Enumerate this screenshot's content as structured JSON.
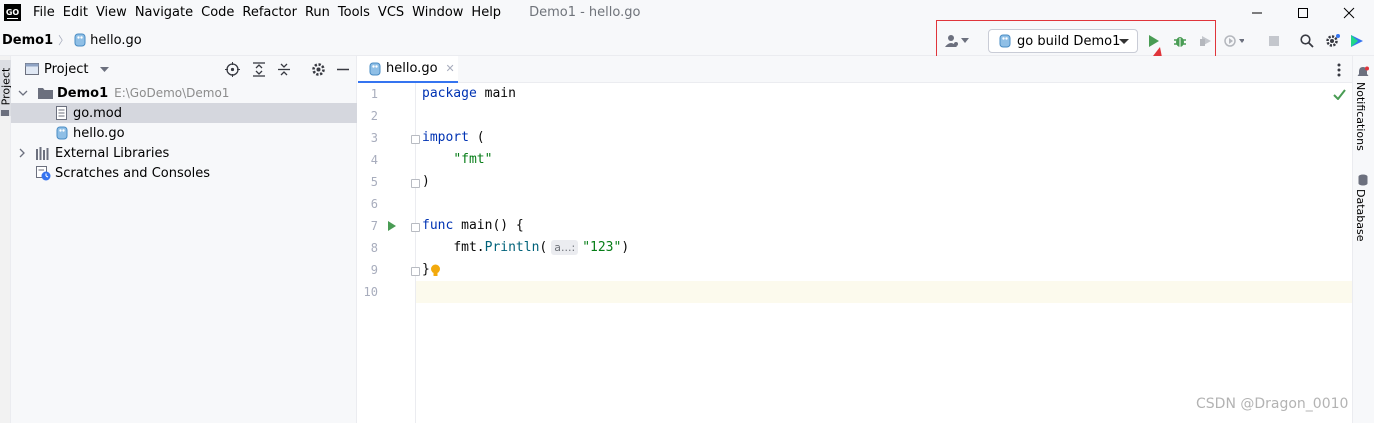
{
  "app": {
    "logo_text": "GO",
    "window_title": "Demo1 - hello.go"
  },
  "menu": [
    "File",
    "Edit",
    "View",
    "Navigate",
    "Code",
    "Refactor",
    "Run",
    "Tools",
    "VCS",
    "Window",
    "Help"
  ],
  "breadcrumb": {
    "project": "Demo1",
    "file": "hello.go"
  },
  "toolbar": {
    "run_config": "go build Demo1",
    "icons": [
      "user-icon",
      "run-icon",
      "debug-icon",
      "coverage-icon",
      "profile-icon",
      "stop-icon",
      "search-icon",
      "settings-icon",
      "plugin-icon"
    ],
    "colors": {
      "run": "#499c54",
      "highlight_box": "#e0353b",
      "arrow": "#e0353b"
    }
  },
  "stripes": {
    "left": "Project",
    "right_top": "Notifications",
    "right_bottom": "Database"
  },
  "project_panel": {
    "title": "Project",
    "tree": [
      {
        "label": "Demo1",
        "hint": "E:\\GoDemo\\Demo1",
        "icon": "folder-icon"
      },
      {
        "label": "go.mod",
        "icon": "gomod-file-icon"
      },
      {
        "label": "hello.go",
        "icon": "go-file-icon"
      },
      {
        "label": "External Libraries",
        "icon": "library-icon"
      },
      {
        "label": "Scratches and Consoles",
        "icon": "scratch-icon"
      }
    ]
  },
  "editor": {
    "tab": "hello.go",
    "line_numbers": [
      "1",
      "2",
      "3",
      "4",
      "5",
      "6",
      "7",
      "8",
      "9",
      "10"
    ],
    "current_line": "10",
    "inlay_hint": "a...:",
    "code": {
      "l1_kw": "package",
      "l1_name": "main",
      "l3_kw": "import",
      "l3_paren": "(",
      "l4_str": "\"fmt\"",
      "l5_paren": ")",
      "l7_kw": "func",
      "l7_rest": "main() {",
      "l8_pkg": "fmt.",
      "l8_fn": "Println",
      "l8_open": "(",
      "l8_str": "\"123\"",
      "l8_close": ")",
      "l9_brace": "}"
    }
  },
  "watermark": "CSDN @Dragon_0010"
}
